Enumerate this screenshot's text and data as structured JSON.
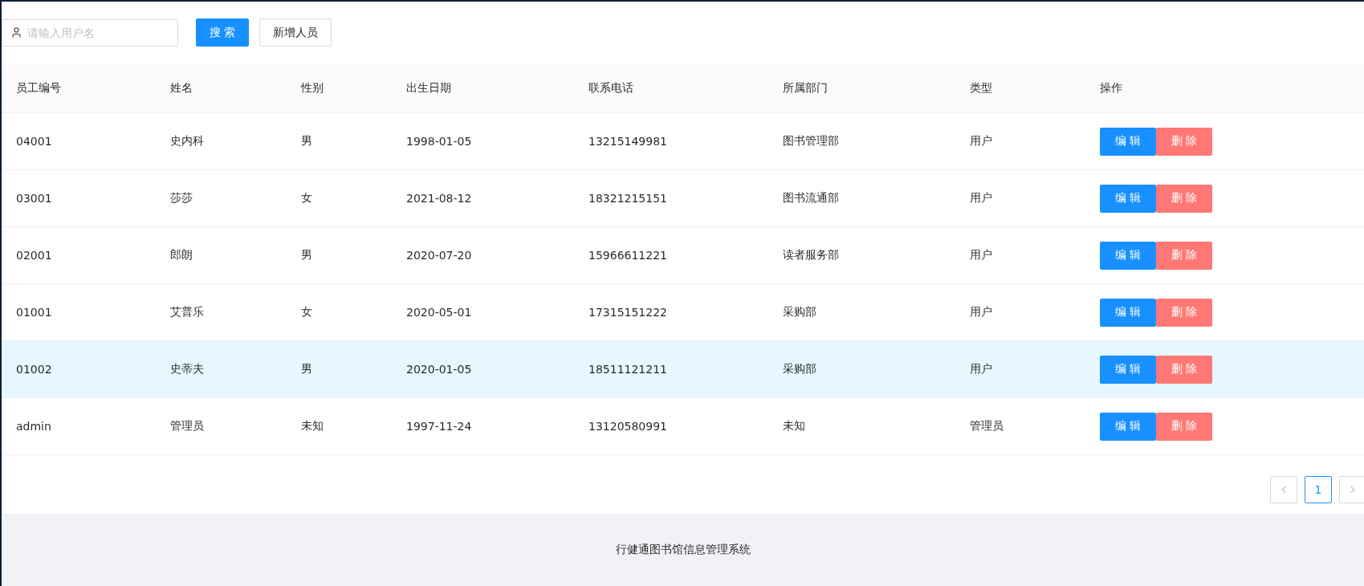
{
  "toolbar": {
    "search": {
      "placeholder": "请输入用户名"
    },
    "buttons": [
      {
        "kind": "primary",
        "label": "搜 索"
      },
      {
        "kind": "default",
        "label": "新增人员"
      }
    ]
  },
  "table": {
    "columns": [
      "员工编号",
      "姓名",
      "性别",
      "出生日期",
      "联系电话",
      "所属部门",
      "类型",
      "操作"
    ],
    "rows": [
      {
        "cells": [
          "04001",
          "史内科",
          "男",
          "1998-01-05",
          "13215149981",
          "图书管理部",
          "用户"
        ],
        "selected": false,
        "actions": [
          "编 辑",
          "删 除"
        ]
      },
      {
        "cells": [
          "03001",
          "莎莎",
          "女",
          "2021-08-12",
          "18321215151",
          "图书流通部",
          "用户"
        ],
        "selected": false,
        "actions": [
          "编 辑",
          "删 除"
        ]
      },
      {
        "cells": [
          "02001",
          "郎朗",
          "男",
          "2020-07-20",
          "15966611221",
          "读者服务部",
          "用户"
        ],
        "selected": false,
        "actions": [
          "编 辑",
          "删 除"
        ]
      },
      {
        "cells": [
          "01001",
          "艾普乐",
          "女",
          "2020-05-01",
          "17315151222",
          "采购部",
          "用户"
        ],
        "selected": false,
        "actions": [
          "编 辑",
          "删 除"
        ]
      },
      {
        "cells": [
          "01002",
          "史蒂夫",
          "男",
          "2020-01-05",
          "18511121211",
          "采购部",
          "用户"
        ],
        "selected": true,
        "actions": [
          "编 辑",
          "删 除"
        ]
      },
      {
        "cells": [
          "admin",
          "管理员",
          "未知",
          "1997-11-24",
          "13120580991",
          "未知",
          "管理员"
        ],
        "selected": false,
        "actions": [
          "编 辑",
          "删 除"
        ]
      }
    ]
  },
  "pagination": {
    "pages": [
      {
        "label": "1",
        "selected": true
      }
    ]
  },
  "footer": {
    "text": "行健通图书馆信息管理系统"
  }
}
